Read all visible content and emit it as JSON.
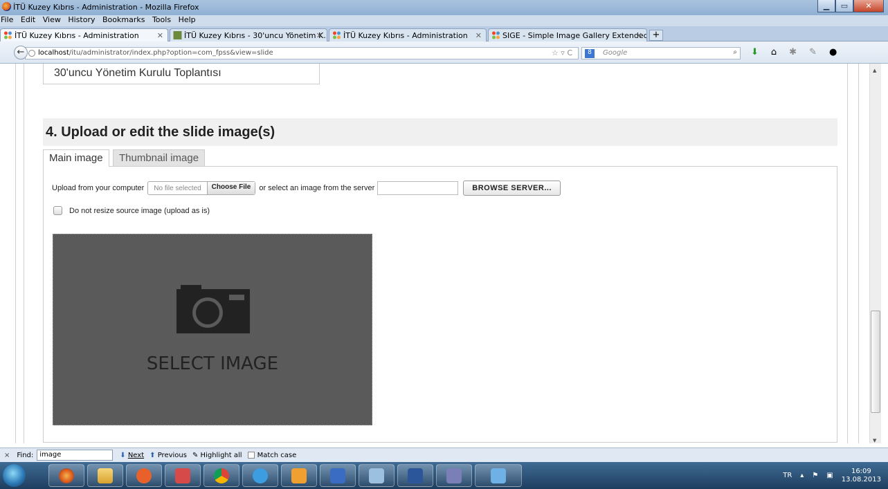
{
  "window": {
    "title": "İTÜ Kuzey Kıbrıs - Administration - Mozilla Firefox"
  },
  "menu": [
    "File",
    "Edit",
    "View",
    "History",
    "Bookmarks",
    "Tools",
    "Help"
  ],
  "tabs": [
    {
      "label": "İTÜ Kuzey Kıbrıs - Administration",
      "active": true
    },
    {
      "label": "İTÜ Kuzey Kıbrıs - 30'uncu Yönetim K...",
      "active": false
    },
    {
      "label": "İTÜ Kuzey Kıbrıs - Administration",
      "active": false
    },
    {
      "label": "SIGE - Simple Image Gallery Extended...",
      "active": false
    }
  ],
  "nav": {
    "url_host": "localhost",
    "url_rest": "/itu/administrator/index.php?option=com_fpss&view=slide",
    "search_placeholder": "Google"
  },
  "page": {
    "title_field_value": "30'uncu Yönetim Kurulu Toplantısı",
    "section_heading": "4. Upload or edit the slide image(s)",
    "image_tabs": [
      "Main image",
      "Thumbnail image"
    ],
    "upload_label": "Upload from your computer",
    "file_status": "No file selected",
    "choose_file": "Choose File",
    "server_label": "or select an image from the server",
    "browse_server": "BROWSE SERVER...",
    "no_resize_label": "Do not resize source image (upload as is)",
    "select_image": "SELECT IMAGE"
  },
  "findbar": {
    "close": "×",
    "label": "Find:",
    "value": "image",
    "next": "Next",
    "previous": "Previous",
    "highlight_all": "Highlight all",
    "match_case": "Match case"
  },
  "taskbar": {
    "apps": [
      "firefox",
      "explorer",
      "media-player",
      "snipping-tool",
      "chrome",
      "internet-explorer",
      "outlook",
      "visio",
      "paint",
      "word",
      "access",
      "notepad"
    ]
  },
  "tray": {
    "lang": "TR",
    "time": "16:09",
    "date": "13.08.2013"
  }
}
